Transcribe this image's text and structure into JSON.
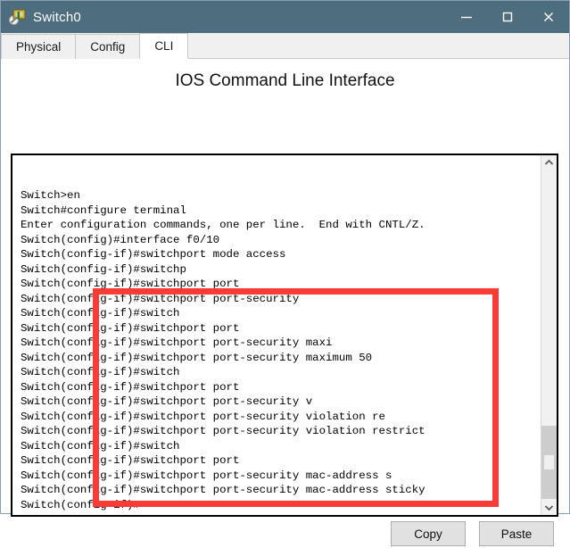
{
  "window": {
    "title": "Switch0",
    "icon": "switch-device-icon",
    "minimize_label": "–",
    "maximize_label": "□",
    "close_label": "✕",
    "border_color": "#8ba0b3",
    "titlebar_color": "#4e6e80"
  },
  "tabs": [
    {
      "label": "Physical",
      "active": false
    },
    {
      "label": "Config",
      "active": false
    },
    {
      "label": "CLI",
      "active": true
    }
  ],
  "heading": "IOS Command Line Interface",
  "terminal": {
    "lines": [
      "",
      "",
      "Switch>en",
      "Switch#configure terminal",
      "Enter configuration commands, one per line.  End with CNTL/Z.",
      "Switch(config)#interface f0/10",
      "Switch(config-if)#switchport mode access",
      "Switch(config-if)#switchp",
      "Switch(config-if)#switchport port",
      "Switch(config-if)#switchport port-security",
      "Switch(config-if)#switch",
      "Switch(config-if)#switchport port",
      "Switch(config-if)#switchport port-security maxi",
      "Switch(config-if)#switchport port-security maximum 50",
      "Switch(config-if)#switch",
      "Switch(config-if)#switchport port",
      "Switch(config-if)#switchport port-security v",
      "Switch(config-if)#switchport port-security violation re",
      "Switch(config-if)#switchport port-security violation restrict",
      "Switch(config-if)#switch",
      "Switch(config-if)#switchport port",
      "Switch(config-if)#switchport port-security mac-address s",
      "Switch(config-if)#switchport port-security mac-address sticky",
      "Switch(config-if)#"
    ],
    "text_color": "#000000",
    "background_color": "#ffffff"
  },
  "annotation": {
    "name": "red-highlight-rectangle",
    "color": "#fb3b36"
  },
  "scrollbar": {
    "up_arrow": "chevron-up-icon",
    "down_arrow": "chevron-down-icon"
  },
  "buttons": {
    "copy_label": "Copy",
    "paste_label": "Paste"
  }
}
